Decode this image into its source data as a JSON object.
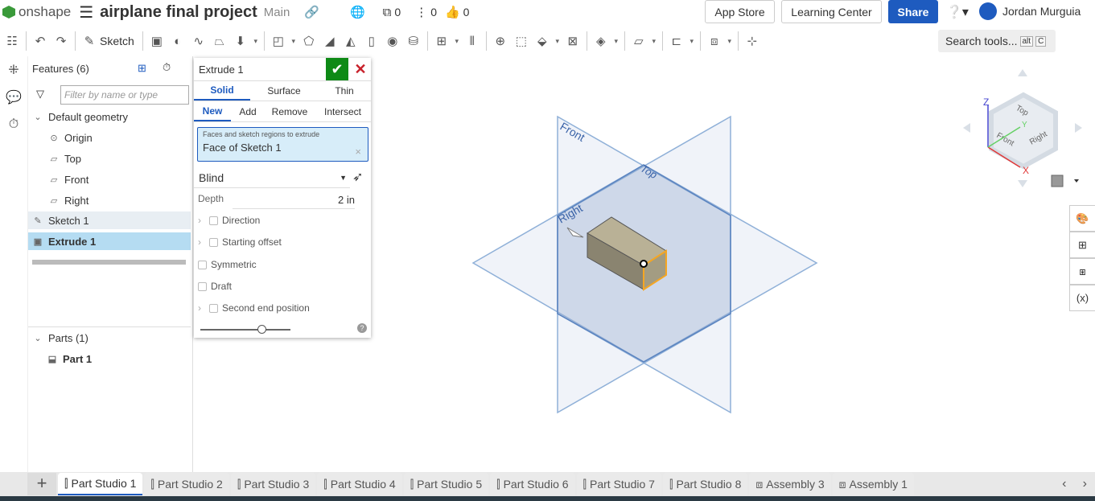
{
  "header": {
    "brand": "onshape",
    "doc_title": "airplane final project",
    "branch": "Main",
    "counts": {
      "versions": "0",
      "branches": "0",
      "likes": "0"
    },
    "app_store": "App Store",
    "learning_center": "Learning Center",
    "share": "Share",
    "user": "Jordan Murguia"
  },
  "toolbar": {
    "sketch": "Sketch",
    "search": "Search tools...",
    "kbd1": "alt",
    "kbd2": "C"
  },
  "features": {
    "title": "Features (6)",
    "filter_placeholder": "Filter by name or type",
    "items": [
      {
        "label": "Default geometry"
      },
      {
        "label": "Origin"
      },
      {
        "label": "Top"
      },
      {
        "label": "Front"
      },
      {
        "label": "Right"
      },
      {
        "label": "Sketch 1"
      },
      {
        "label": "Extrude 1"
      }
    ],
    "parts_title": "Parts (1)",
    "part": "Part 1"
  },
  "dialog": {
    "title": "Extrude 1",
    "body_tabs": [
      "Solid",
      "Surface",
      "Thin"
    ],
    "op_tabs": [
      "New",
      "Add",
      "Remove",
      "Intersect"
    ],
    "selection_label": "Faces and sketch regions to extrude",
    "selection_value": "Face of Sketch 1",
    "end_type": "Blind",
    "depth_label": "Depth",
    "depth_value": "2 in",
    "options": [
      "Direction",
      "Starting offset",
      "Symmetric",
      "Draft",
      "Second end position"
    ]
  },
  "viewport": {
    "plane_labels": [
      "Front",
      "Top",
      "Right"
    ],
    "cube_faces": [
      "Top",
      "Front",
      "Right"
    ],
    "axes": [
      "X",
      "Y",
      "Z"
    ]
  },
  "tabs": [
    "Part Studio 1",
    "Part Studio 2",
    "Part Studio 3",
    "Part Studio 4",
    "Part Studio 5",
    "Part Studio 6",
    "Part Studio 7",
    "Part Studio 8",
    "Assembly 3",
    "Assembly 1"
  ],
  "colors": {
    "accent": "#1e5bbf",
    "ok": "#0e8a16",
    "cancel": "#c8202a",
    "selection": "#f5a623"
  }
}
